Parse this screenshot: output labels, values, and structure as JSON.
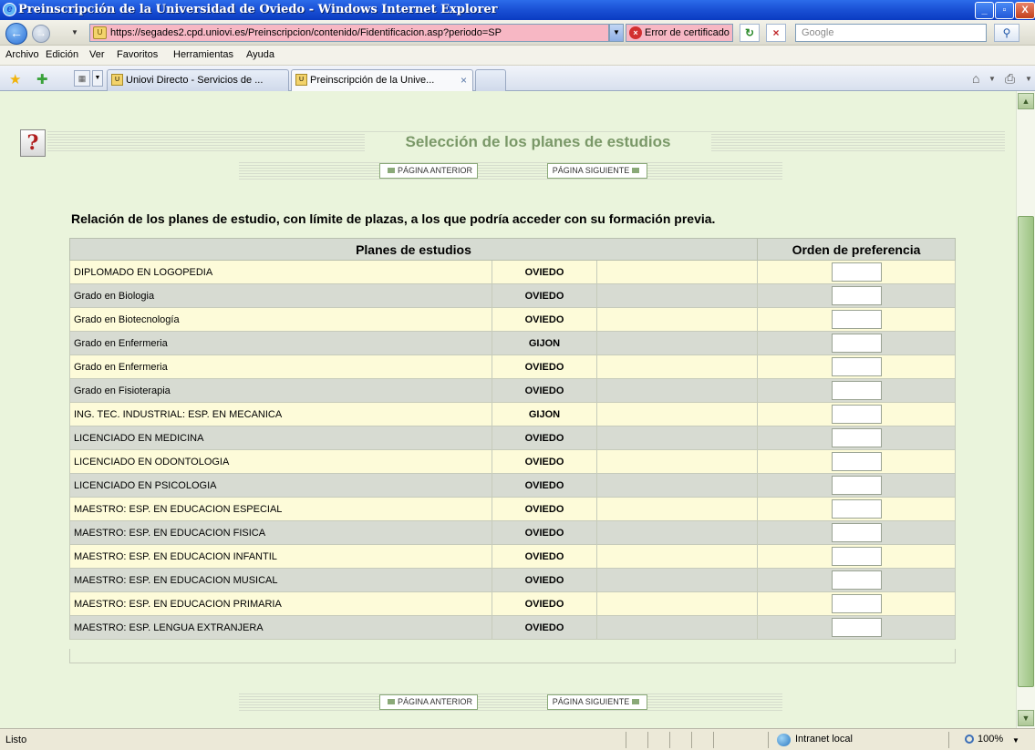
{
  "window": {
    "title": "Preinscripción de la Universidad de Oviedo - Windows Internet Explorer",
    "minimize": "_",
    "maximize": "▫",
    "close": "X"
  },
  "address_bar": {
    "url": "https://segades2.cpd.uniovi.es/Preinscripcion/contenido/Fidentificacion.asp?periodo=SP",
    "cert_error": "Error de certificado",
    "search_placeholder": "Google"
  },
  "menu": [
    "Archivo",
    "Edición",
    "Ver",
    "Favoritos",
    "Herramientas",
    "Ayuda"
  ],
  "tabs": [
    {
      "label": "Uniovi Directo - Servicios de ..."
    },
    {
      "label": "Preinscripción de la Unive..."
    }
  ],
  "page": {
    "heading": "Selección de los planes de estudios",
    "prev_label": "PÁGINA ANTERIOR",
    "next_label": "PÁGINA SIGUIENTE",
    "intro": "Relación de los planes de estudio, con límite de plazas, a los que podría acceder con su formación previa.",
    "col_plans": "Planes de estudios",
    "col_pref": "Orden de preferencia",
    "help_glyph": "?"
  },
  "plans": [
    {
      "name": "DIPLOMADO EN LOGOPEDIA",
      "city": "OVIEDO"
    },
    {
      "name": "Grado en Biologia",
      "city": "OVIEDO"
    },
    {
      "name": "Grado en Biotecnología",
      "city": "OVIEDO"
    },
    {
      "name": "Grado en Enfermeria",
      "city": "GIJON"
    },
    {
      "name": "Grado en Enfermeria",
      "city": "OVIEDO"
    },
    {
      "name": "Grado en Fisioterapia",
      "city": "OVIEDO"
    },
    {
      "name": "ING. TEC. INDUSTRIAL: ESP. EN MECANICA",
      "city": "GIJON"
    },
    {
      "name": "LICENCIADO EN MEDICINA",
      "city": "OVIEDO"
    },
    {
      "name": "LICENCIADO EN ODONTOLOGIA",
      "city": "OVIEDO"
    },
    {
      "name": "LICENCIADO EN PSICOLOGIA",
      "city": "OVIEDO"
    },
    {
      "name": "MAESTRO: ESP. EN EDUCACION ESPECIAL",
      "city": "OVIEDO"
    },
    {
      "name": "MAESTRO: ESP. EN EDUCACION FISICA",
      "city": "OVIEDO"
    },
    {
      "name": "MAESTRO: ESP. EN EDUCACION INFANTIL",
      "city": "OVIEDO"
    },
    {
      "name": "MAESTRO: ESP. EN EDUCACION MUSICAL",
      "city": "OVIEDO"
    },
    {
      "name": "MAESTRO: ESP. EN EDUCACION PRIMARIA",
      "city": "OVIEDO"
    },
    {
      "name": "MAESTRO: ESP. LENGUA EXTRANJERA",
      "city": "OVIEDO"
    }
  ],
  "status": {
    "text": "Listo",
    "zone": "Intranet local",
    "zoom": "100%"
  }
}
